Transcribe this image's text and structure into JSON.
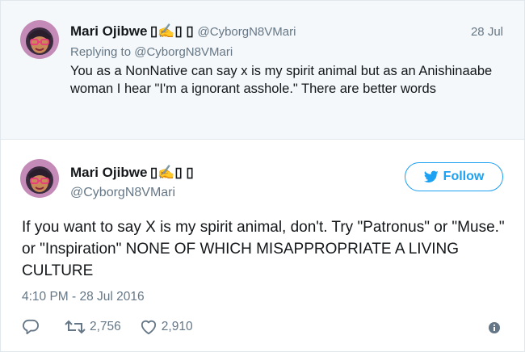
{
  "parent_tweet": {
    "name": "Mari Ojibwe ▯✍▯ ▯",
    "handle": "@CyborgN8VMari",
    "date": "28 Jul",
    "replying_prefix": "Replying to ",
    "replying_handle": "@CyborgN8VMari",
    "text": "You as a NonNative can say x is my spirit animal but as an Anishinaabe woman I hear \"I'm a ignorant asshole.\" There are better words"
  },
  "main_tweet": {
    "name": "Mari Ojibwe ▯✍▯ ▯",
    "handle": "@CyborgN8VMari",
    "follow_label": "Follow",
    "text": "If you want to say X is my spirit animal, don't. Try \"Patronus\" or \"Muse.\" or \"Inspiration\" NONE OF WHICH MISAPPROPRIATE A LIVING CULTURE",
    "timestamp": "4:10 PM - 28 Jul 2016",
    "retweet_count": "2,756",
    "like_count": "2,910"
  },
  "icons": {
    "reply": "reply-icon",
    "retweet": "retweet-icon",
    "like": "heart-icon",
    "info": "info-icon",
    "twitter_bird": "twitter-bird-icon"
  },
  "colors": {
    "accent": "#1da1f2",
    "muted": "#657786",
    "parent_bg": "#f5f8fa",
    "text": "#14171a"
  }
}
